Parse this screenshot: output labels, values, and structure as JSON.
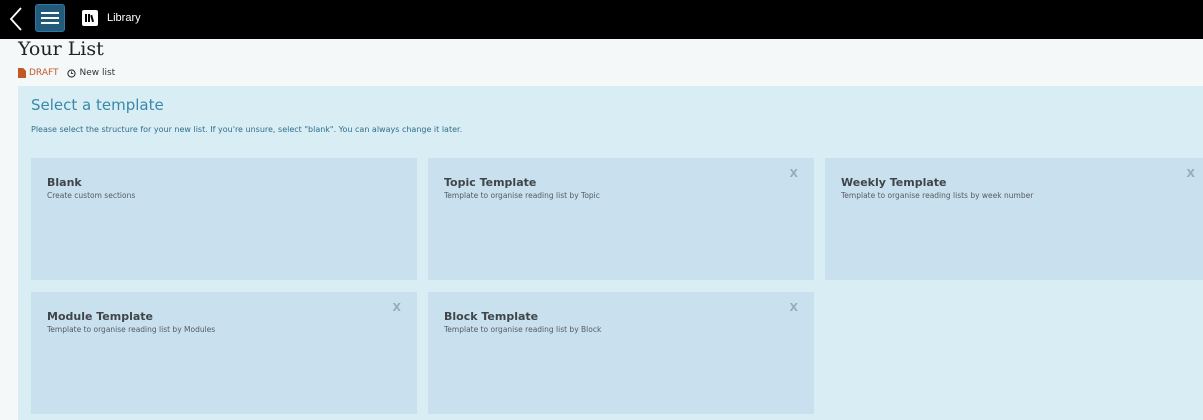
{
  "topbar": {
    "back_icon": "chevron-left-icon",
    "menu_icon": "hamburger-icon",
    "library_icon": "library-icon",
    "library_label": "Library"
  },
  "page": {
    "title": "Your List",
    "status_badge": "DRAFT",
    "status_text": "New list"
  },
  "template_panel": {
    "title": "Select a template",
    "description": "Please select the structure for your new list. If you're unsure, select \"blank\". You can always change it later.",
    "cards": [
      {
        "title": "Blank",
        "description": "Create custom sections",
        "close": ""
      },
      {
        "title": "Topic Template",
        "description": "Template to organise reading list by Topic",
        "close": "X"
      },
      {
        "title": "Weekly Template",
        "description": "Template to organise reading lists by week number",
        "close": "X"
      },
      {
        "title": "Module Template",
        "description": "Template to organise reading list by Modules",
        "close": "X"
      },
      {
        "title": "Block Template",
        "description": "Template to organise reading list by Block",
        "close": "X"
      }
    ]
  },
  "colors": {
    "topbar": "#000000",
    "menu_button": "#215a7a",
    "draft": "#bf5a25",
    "panel": "#d9edf5",
    "card": "#c9e1ee",
    "panel_title": "#3a89a8"
  }
}
